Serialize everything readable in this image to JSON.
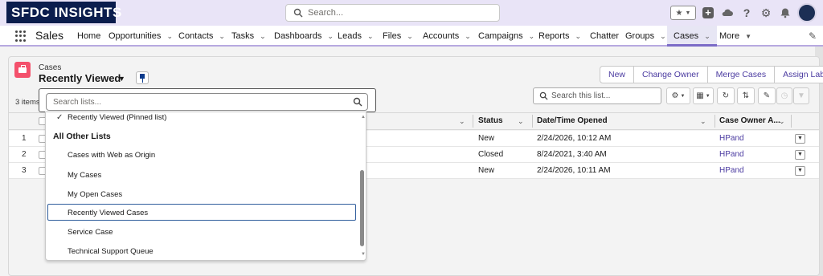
{
  "header": {
    "brand": "SFDC INSIGHTS",
    "search_placeholder": "Search...",
    "icons": [
      "star-icon",
      "chevron-down-icon",
      "plus-icon",
      "cloud-icon",
      "help-icon",
      "gear-icon",
      "bell-icon",
      "avatar"
    ]
  },
  "nav": {
    "app_name": "Sales",
    "items": [
      {
        "label": "Home"
      },
      {
        "label": "Opportunities"
      },
      {
        "label": "Contacts"
      },
      {
        "label": "Tasks"
      },
      {
        "label": "Dashboards"
      },
      {
        "label": "Leads"
      },
      {
        "label": "Files"
      },
      {
        "label": "Accounts"
      },
      {
        "label": "Campaigns"
      },
      {
        "label": "Reports"
      },
      {
        "label": "Chatter"
      },
      {
        "label": "Groups"
      },
      {
        "label": "Cases"
      },
      {
        "label": "More"
      }
    ],
    "active": "Cases"
  },
  "list_header": {
    "object_label": "Cases",
    "title": "Recently Viewed",
    "item_count": "3 items",
    "buttons": {
      "new": "New",
      "change_owner": "Change Owner",
      "merge_cases": "Merge Cases",
      "assign_label": "Assign Label"
    },
    "search_placeholder": "Search this list..."
  },
  "picker": {
    "search_placeholder": "Search lists...",
    "pinned": "Recently Viewed (Pinned list)",
    "heading": "All Other Lists",
    "items": [
      {
        "label": "Cases with Web as Origin"
      },
      {
        "label": "My Cases"
      },
      {
        "label": "My Open Cases"
      },
      {
        "label": "Recently Viewed Cases"
      },
      {
        "label": "Service Case"
      },
      {
        "label": "Technical Support Queue"
      }
    ],
    "selected": "Recently Viewed Cases"
  },
  "table": {
    "columns": {
      "status": "Status",
      "opened": "Date/Time Opened",
      "owner": "Case Owner A..."
    },
    "rows": [
      {
        "num": "1",
        "status": "New",
        "opened": "2/24/2026, 10:12 AM",
        "owner": "HPand"
      },
      {
        "num": "2",
        "status": "Closed",
        "opened": "8/24/2021, 3:40 AM",
        "owner": "HPand"
      },
      {
        "num": "3",
        "status": "New",
        "opened": "2/24/2026, 10:11 AM",
        "owner": "HPand"
      }
    ]
  },
  "colors": {
    "brand_bg": "#0b1d4d",
    "header_bg": "#e9e4f7",
    "accent": "#4a3aa0",
    "case_icon": "#f4516c",
    "selected_border": "#2f5d9c"
  }
}
